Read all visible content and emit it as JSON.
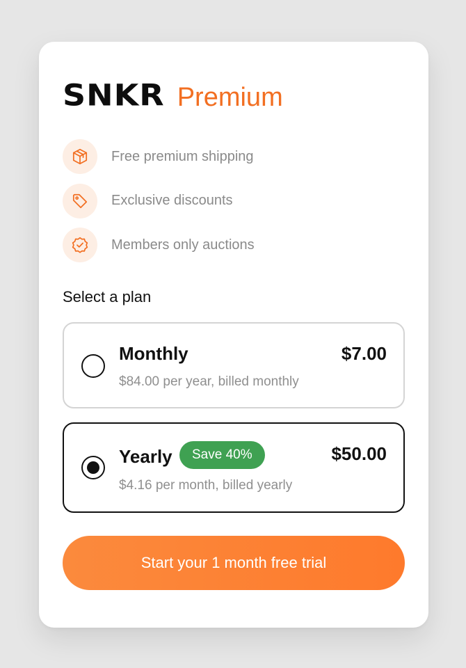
{
  "brand": {
    "logo": "SNKR",
    "product": "Premium"
  },
  "features": [
    {
      "icon": "package-icon",
      "label": "Free premium shipping"
    },
    {
      "icon": "tag-icon",
      "label": "Exclusive discounts"
    },
    {
      "icon": "verified-badge-icon",
      "label": "Members only auctions"
    }
  ],
  "plans_section": {
    "title": "Select a plan",
    "plans": [
      {
        "name": "Monthly",
        "price": "$7.00",
        "subtitle": "$84.00 per year, billed monthly",
        "selected": false
      },
      {
        "name": "Yearly",
        "badge": "Save 40%",
        "price": "$50.00",
        "subtitle": "$4.16 per month, billed yearly",
        "selected": true
      }
    ]
  },
  "cta": {
    "label": "Start your 1 month free trial"
  },
  "colors": {
    "accent": "#f26f22",
    "badge": "#3fa152",
    "icon_bg": "#fdeee4"
  }
}
